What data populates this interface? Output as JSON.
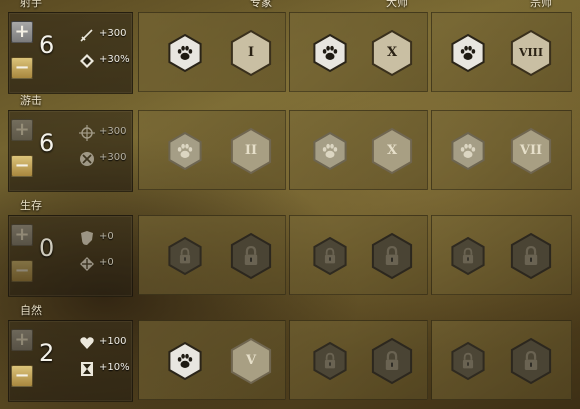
{
  "columns": [
    {
      "key": "expert",
      "label": "专家"
    },
    {
      "key": "master",
      "label": "大师"
    },
    {
      "key": "grandmaster",
      "label": "宗师"
    }
  ],
  "sections": [
    {
      "key": "marksmanship",
      "title": "射手",
      "points": "6",
      "plus_enabled": true,
      "minus_enabled": true,
      "stats": [
        {
          "icon": "sword-icon",
          "value": "+300"
        },
        {
          "icon": "crit-diamond-icon",
          "value": "+30%"
        }
      ],
      "tiers": [
        {
          "trait": "paw-icon",
          "trait_state": "active",
          "rank": "I",
          "rank_state": "active"
        },
        {
          "trait": "paw-icon",
          "trait_state": "active",
          "rank": "X",
          "rank_state": "active"
        },
        {
          "trait": "paw-icon",
          "trait_state": "active",
          "rank": "VIII",
          "rank_state": "active"
        }
      ]
    },
    {
      "key": "skirmishing",
      "title": "游击",
      "points": "6",
      "plus_enabled": false,
      "minus_enabled": true,
      "stats": [
        {
          "icon": "crosshair-icon",
          "value": "+300"
        },
        {
          "icon": "x-circle-icon",
          "value": "+300"
        }
      ],
      "tiers": [
        {
          "trait": "paw-icon",
          "trait_state": "inactive",
          "rank": "II",
          "rank_state": "inactive"
        },
        {
          "trait": "paw-icon",
          "trait_state": "inactive",
          "rank": "X",
          "rank_state": "inactive"
        },
        {
          "trait": "paw-icon",
          "trait_state": "inactive",
          "rank": "VII",
          "rank_state": "inactive"
        }
      ]
    },
    {
      "key": "wilderness-survival",
      "title": "生存",
      "points": "0",
      "plus_enabled": false,
      "minus_enabled": false,
      "stats": [
        {
          "icon": "shield-icon",
          "value": "+0"
        },
        {
          "icon": "diamond-icon",
          "value": "+0"
        }
      ],
      "tiers": [
        {
          "trait": "lock-icon",
          "trait_state": "locked",
          "rank": "lock-icon",
          "rank_state": "locked"
        },
        {
          "trait": "lock-icon",
          "trait_state": "locked",
          "rank": "lock-icon",
          "rank_state": "locked"
        },
        {
          "trait": "lock-icon",
          "trait_state": "locked",
          "rank": "lock-icon",
          "rank_state": "locked"
        }
      ]
    },
    {
      "key": "nature-magic",
      "title": "自然",
      "points": "2",
      "plus_enabled": false,
      "minus_enabled": true,
      "stats": [
        {
          "icon": "heart-icon",
          "value": "+100"
        },
        {
          "icon": "hourglass-icon",
          "value": "+10%"
        }
      ],
      "tiers": [
        {
          "trait": "paw-icon",
          "trait_state": "active",
          "rank": "V",
          "rank_state": "inactive"
        },
        {
          "trait": "lock-icon",
          "trait_state": "locked",
          "rank": "lock-icon",
          "rank_state": "locked"
        },
        {
          "trait": "lock-icon",
          "trait_state": "locked",
          "rank": "lock-icon",
          "rank_state": "locked"
        }
      ]
    }
  ]
}
